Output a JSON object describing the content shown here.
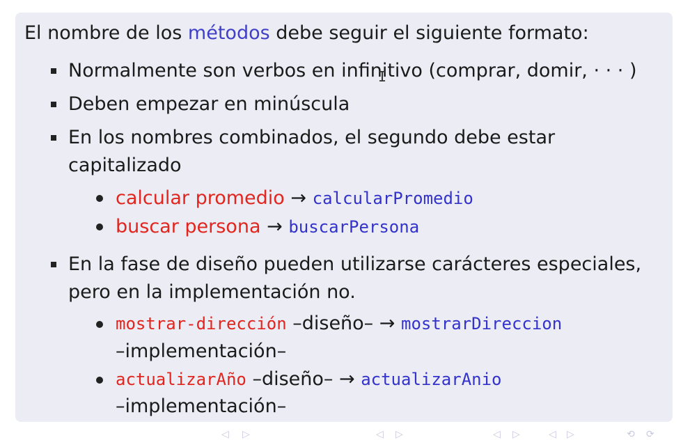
{
  "intro": {
    "before": "El nombre de los ",
    "keyword": "métodos",
    "after": " debe seguir el siguiente formato:"
  },
  "items": [
    {
      "text": "Normalmente son verbos en infinitivo (comprar, domir, · · · )"
    },
    {
      "text": "Deben empezar en minúscula"
    },
    {
      "line1": "En los nombres combinados, el segundo debe estar",
      "line2": "capitalizado"
    },
    {
      "line1": "En la fase de diseño pueden utilizarse carácteres especiales,",
      "line2": "pero en la implementación no."
    }
  ],
  "examples_camel": [
    {
      "phrase": "calcular promedio",
      "arrow": "→",
      "code": "calcularPromedio"
    },
    {
      "phrase": "buscar persona",
      "arrow": "→",
      "code": "buscarPersona"
    }
  ],
  "examples_special": [
    {
      "design_code": "mostrar-dirección",
      "design_tag": "–diseño–",
      "arrow": "→",
      "impl_code": "mostrarDireccion",
      "impl_tag": "–implementación–"
    },
    {
      "design_code": "actualizarAño",
      "design_tag": "–diseño–",
      "arrow": "→",
      "impl_code": "actualizarAnio",
      "impl_tag": "–implementación–"
    }
  ],
  "footer_nav": [
    "◁",
    "▷",
    "◁",
    "▷",
    "◁",
    "▷",
    "◁",
    "▷",
    "⟲",
    "⟳"
  ],
  "colors": {
    "block_bg": "#ececf5",
    "accent": "#3f3fc8",
    "red": "#e0261e",
    "blue": "#3333cc"
  }
}
